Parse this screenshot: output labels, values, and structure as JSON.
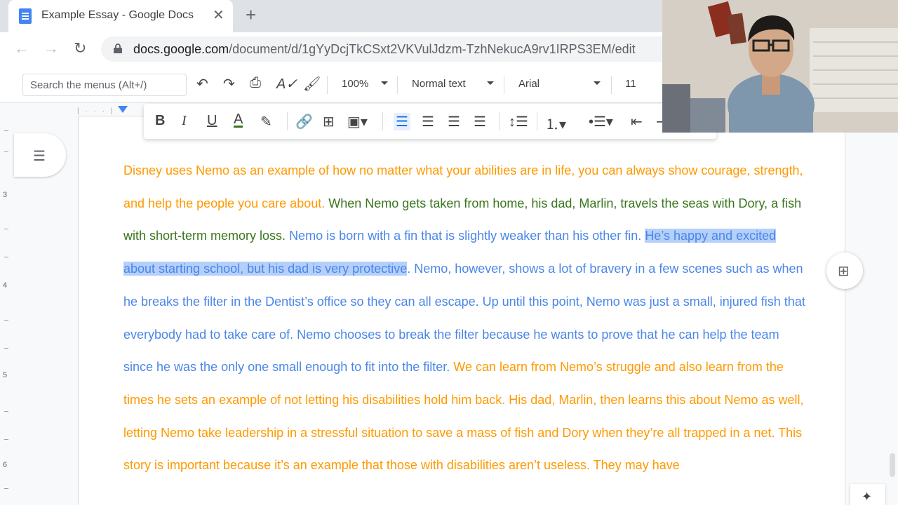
{
  "browser": {
    "tab_title": "Example Essay - Google Docs",
    "url_host": "docs.google.com",
    "url_path": "/document/d/1gYyDcjTkCSxt2VKVulJdzm-TzhNekucA9rv1IRPS3EM/edit"
  },
  "toolbar": {
    "search_placeholder": "Search the menus (Alt+/)",
    "zoom": "100%",
    "style": "Normal text",
    "font": "Arial",
    "font_size": "11"
  },
  "ruler": {
    "numbers": [
      "3",
      "4",
      "5",
      "6"
    ]
  },
  "essay": {
    "s1": "Disney uses Nemo as an example of how no matter what your abilities are in life, you can always show courage, strength, and help the people you care about.",
    "s2": "When Nemo gets taken from home, his dad, Marlin, travels the seas with Dory, a fish with short-term memory loss.",
    "s3": "Nemo is born with a fin that is slightly weaker than his other fin.",
    "s4_selected": "He’s happy and excited about starting school, but his dad is very protective",
    "s5": ". Nemo, however, shows a lot of bravery in a few scenes such as when he breaks the filter in the Dentist’s office so they can all escape. Up until this point, Nemo was just a small, injured fish that everybody had to take care of. Nemo chooses to break the filter because he wants to prove that he can help the team since he was the only one small enough to fit into the filter.",
    "s6": "We can learn from Nemo’s struggle and also learn from the times he sets an example of not letting his disabilities hold him back. His dad, Marlin, then learns this about Nemo as well, letting Nemo take leadership in a stressful situation to save a mass of fish and Dory when they’re all trapped in a net. This story is important because it’s an example that those with disabilities aren’t useless. They may have"
  },
  "colors": {
    "orange": "#ff9900",
    "green": "#38761d",
    "blue": "#4a86e8",
    "highlight": "#b4cffa",
    "docs_blue": "#4285f4"
  },
  "icons": [
    "docs-icon",
    "close-icon",
    "plus-icon",
    "back-icon",
    "forward-icon",
    "reload-icon",
    "lock-icon",
    "undo-icon",
    "redo-icon",
    "print-icon",
    "spellcheck-icon",
    "paint-format-icon",
    "bold-icon",
    "italic-icon",
    "underline-icon",
    "text-color-icon",
    "highlight-icon",
    "link-icon",
    "add-comment-icon",
    "image-icon",
    "align-left-icon",
    "align-center-icon",
    "align-right-icon",
    "justify-icon",
    "line-spacing-icon",
    "numbered-list-icon",
    "bulleted-list-icon",
    "decrease-indent-icon",
    "outline-icon",
    "explore-icon"
  ]
}
